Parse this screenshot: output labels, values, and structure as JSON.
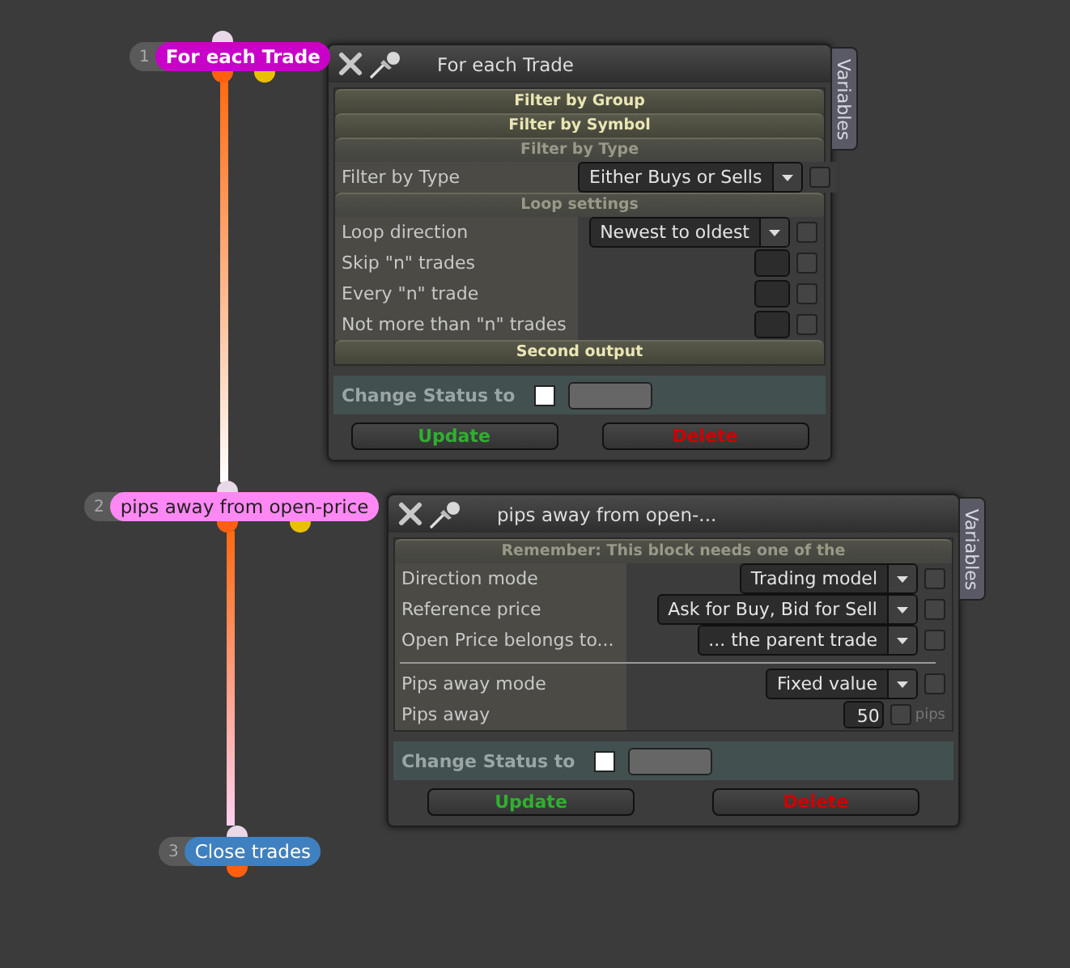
{
  "nodes": [
    {
      "number": "1",
      "label": "For each Trade",
      "color": "#c800c8",
      "bold": true
    },
    {
      "number": "2",
      "label": "pips away from open-price",
      "color": "#ff88f4",
      "bold": false
    },
    {
      "number": "3",
      "label": "Close trades",
      "color": "#3f80c0",
      "bold": false
    }
  ],
  "panels": [
    {
      "title": "For each Trade",
      "side_tab": "Variables",
      "rows": [
        {
          "kind": "header",
          "label": "Filter by Group",
          "expanded": false
        },
        {
          "kind": "header",
          "label": "Filter by Symbol",
          "expanded": false
        },
        {
          "kind": "header",
          "label": "Filter by Type",
          "expanded": true
        },
        {
          "kind": "select",
          "label": "Filter by Type",
          "value": "Either Buys or Sells",
          "checked": false
        },
        {
          "kind": "header",
          "label": "Loop settings",
          "expanded": true
        },
        {
          "kind": "select",
          "label": "Loop direction",
          "value": "Newest to oldest",
          "checked": false
        },
        {
          "kind": "number",
          "label": "Skip \"n\" trades",
          "checked": false
        },
        {
          "kind": "number",
          "label": "Every \"n\" trade",
          "checked": false
        },
        {
          "kind": "number",
          "label": "Not more than \"n\" trades",
          "checked": false
        },
        {
          "kind": "header",
          "label": "Second output",
          "expanded": false
        }
      ],
      "status": {
        "label": "Change Status to",
        "checked": false
      },
      "buttons": [
        {
          "label": "Update",
          "kind": "update"
        },
        {
          "label": "Delete",
          "kind": "delete"
        }
      ]
    },
    {
      "title": "pips away from open-...",
      "side_tab": "Variables",
      "rows": [
        {
          "kind": "header",
          "label": "Remember: This block needs one of the",
          "expanded": true
        },
        {
          "kind": "select",
          "label": "Direction mode",
          "value": "Trading model",
          "checked": false
        },
        {
          "kind": "select",
          "label": "Reference price",
          "value": "Ask for Buy, Bid for Sell",
          "checked": false
        },
        {
          "kind": "select",
          "label": "Open Price belongs to...",
          "value": "... the parent trade",
          "checked": false
        },
        {
          "kind": "divider"
        },
        {
          "kind": "select",
          "label": "Pips away mode",
          "value": "Fixed value",
          "checked": false
        },
        {
          "kind": "number",
          "label": "Pips away",
          "value": "50",
          "unit": "pips",
          "checked": false
        }
      ],
      "status": {
        "label": "Change Status to",
        "checked": false
      },
      "buttons": [
        {
          "label": "Update",
          "kind": "update"
        },
        {
          "label": "Delete",
          "kind": "delete"
        }
      ]
    }
  ]
}
